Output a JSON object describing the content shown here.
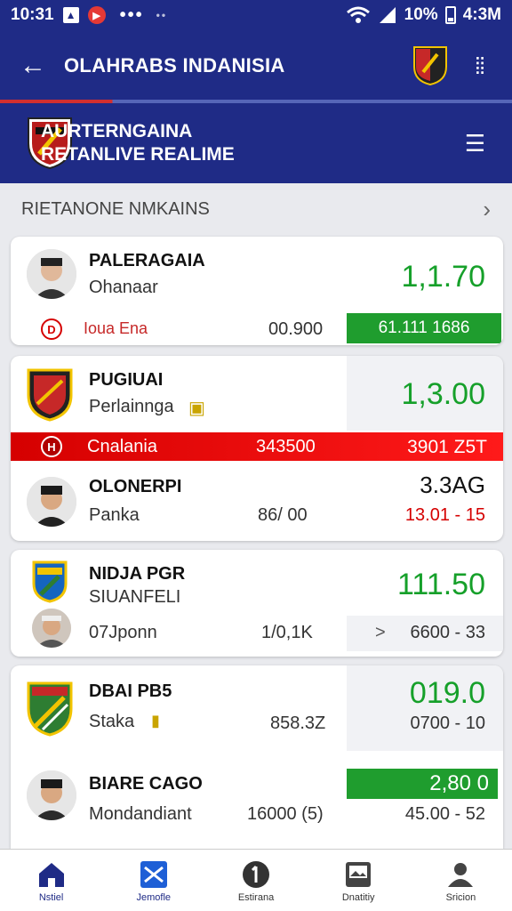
{
  "status_bar": {
    "time": "10:31",
    "battery": "10%",
    "clock": "4:3M"
  },
  "app_bar": {
    "title": "OLAHRABS INDANISIA"
  },
  "header": {
    "line1": "AURTERNGAINA",
    "line2": "RETANLIVE REALIME"
  },
  "section": {
    "title": "RIETANONE NMKAINS"
  },
  "cards": [
    {
      "name": "PALERAGAIA",
      "sub": "Ohanaar",
      "score": "1,1.70",
      "row2": {
        "label": "Ioua Ena",
        "mid": "00.900",
        "value": "61.111 1686"
      }
    },
    {
      "name": "PUGIUAI",
      "sub": "Perlainnga",
      "score": "1,3.00",
      "bar": {
        "label": "Cnalania",
        "mid": "343500",
        "value": "3901 Z5T"
      },
      "row3": {
        "name": "OLONERPI",
        "sub": "Panka",
        "mid": "86/ 00",
        "score": "3.3AG",
        "odds": "13.01 - 15"
      }
    },
    {
      "name": "NIDJA PGR",
      "sub": "SIUANFELI",
      "score": "111.50",
      "row2": {
        "label": "07Jponn",
        "mid": "1/0,1K",
        "arrow": ">",
        "value": "6600 - 33"
      }
    },
    {
      "name": "DBAI PB5",
      "sub": "Staka",
      "mid": "858.3Z",
      "score": "019.0",
      "odds": "0700 - 10",
      "row3": {
        "name": "BIARE CAGO",
        "sub": "Mondandiant",
        "mid": "16000 (5)",
        "score": "2,80 0",
        "odds": "45.00 - 52"
      }
    }
  ],
  "bottom_nav": [
    {
      "label": "Nstiel",
      "icon": "home-icon"
    },
    {
      "label": "Jemofle",
      "icon": "matches-icon"
    },
    {
      "label": "Estirana",
      "icon": "stats-icon"
    },
    {
      "label": "Dnatitiy",
      "icon": "gallery-icon"
    },
    {
      "label": "Sricion",
      "icon": "profile-icon"
    }
  ],
  "colors": {
    "primary": "#1f2b86",
    "accent_red": "#d50000",
    "green": "#16a02a"
  }
}
